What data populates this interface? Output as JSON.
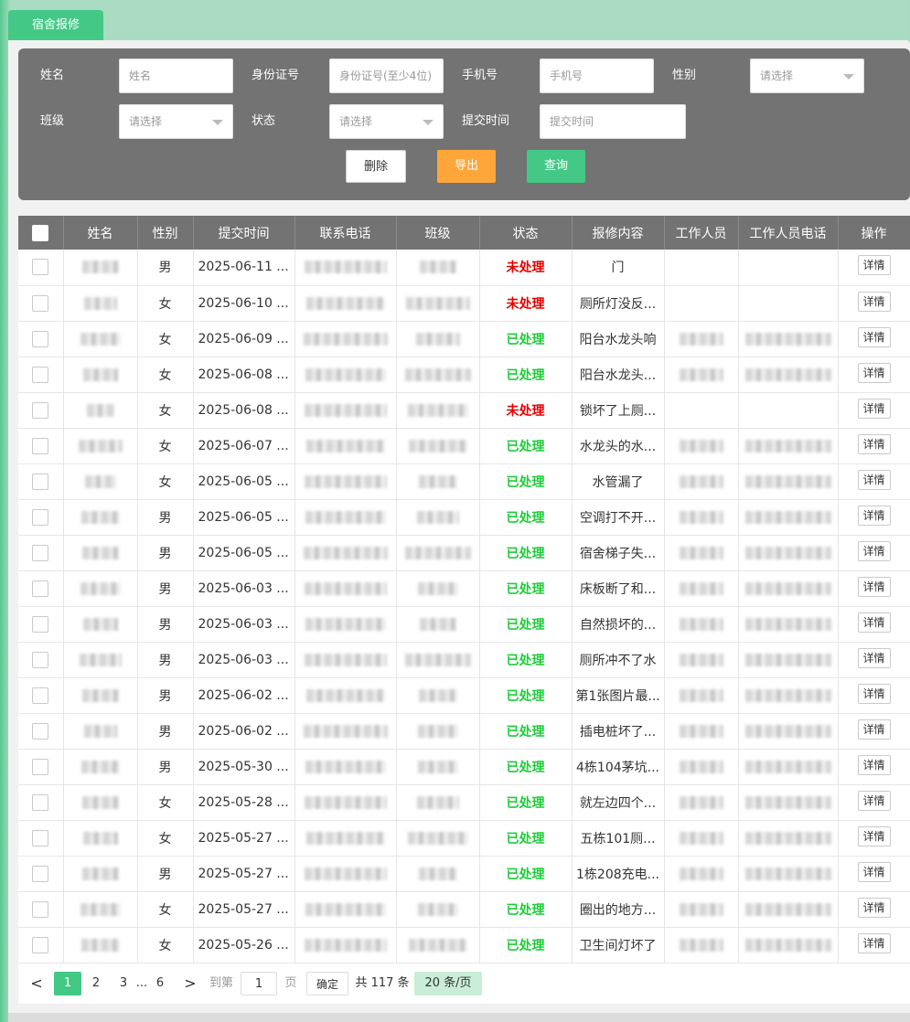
{
  "tab": {
    "label": "宿舍报修"
  },
  "filter": {
    "name_label": "姓名",
    "name_placeholder": "姓名",
    "id_label": "身份证号",
    "id_placeholder": "身份证号(至少4位)",
    "phone_label": "手机号",
    "phone_placeholder": "手机号",
    "gender_label": "性别",
    "gender_placeholder": "请选择",
    "class_label": "班级",
    "class_placeholder": "请选择",
    "status_label": "状态",
    "status_placeholder": "请选择",
    "time_label": "提交时间",
    "time_placeholder": "提交时间",
    "delete_label": "删除",
    "export_label": "导出",
    "query_label": "查询"
  },
  "table": {
    "headers": [
      "姓名",
      "性别",
      "提交时间",
      "联系电话",
      "班级",
      "状态",
      "报修内容",
      "工作人员",
      "工作人员电话",
      "操作"
    ],
    "detail_label": "详情",
    "rows": [
      {
        "gender": "男",
        "time": "2025-06-11 ...",
        "status": "未处理",
        "content": "门",
        "handled": false
      },
      {
        "gender": "女",
        "time": "2025-06-10 ...",
        "status": "未处理",
        "content": "厕所灯没反...",
        "handled": false
      },
      {
        "gender": "女",
        "time": "2025-06-09 ...",
        "status": "已处理",
        "content": "阳台水龙头响",
        "handled": true
      },
      {
        "gender": "女",
        "time": "2025-06-08 ...",
        "status": "已处理",
        "content": "阳台水龙头...",
        "handled": true
      },
      {
        "gender": "女",
        "time": "2025-06-08 ...",
        "status": "未处理",
        "content": "锁坏了上厕...",
        "handled": false
      },
      {
        "gender": "女",
        "time": "2025-06-07 ...",
        "status": "已处理",
        "content": "水龙头的水...",
        "handled": true
      },
      {
        "gender": "女",
        "time": "2025-06-05 ...",
        "status": "已处理",
        "content": "水管漏了",
        "handled": true
      },
      {
        "gender": "男",
        "time": "2025-06-05 ...",
        "status": "已处理",
        "content": "空调打不开...",
        "handled": true
      },
      {
        "gender": "男",
        "time": "2025-06-05 ...",
        "status": "已处理",
        "content": "宿舍梯子失...",
        "handled": true
      },
      {
        "gender": "男",
        "time": "2025-06-03 ...",
        "status": "已处理",
        "content": "床板断了和...",
        "handled": true
      },
      {
        "gender": "男",
        "time": "2025-06-03 ...",
        "status": "已处理",
        "content": "自然损坏的...",
        "handled": true
      },
      {
        "gender": "男",
        "time": "2025-06-03 ...",
        "status": "已处理",
        "content": "厕所冲不了水",
        "handled": true
      },
      {
        "gender": "男",
        "time": "2025-06-02 ...",
        "status": "已处理",
        "content": "第1张图片最...",
        "handled": true
      },
      {
        "gender": "男",
        "time": "2025-06-02 ...",
        "status": "已处理",
        "content": "插电桩坏了...",
        "handled": true
      },
      {
        "gender": "男",
        "time": "2025-05-30 ...",
        "status": "已处理",
        "content": "4栋104茅坑...",
        "handled": true
      },
      {
        "gender": "女",
        "time": "2025-05-28 ...",
        "status": "已处理",
        "content": "就左边四个...",
        "handled": true
      },
      {
        "gender": "女",
        "time": "2025-05-27 ...",
        "status": "已处理",
        "content": "五栋101厕...",
        "handled": true
      },
      {
        "gender": "男",
        "time": "2025-05-27 ...",
        "status": "已处理",
        "content": "1栋208充电...",
        "handled": true
      },
      {
        "gender": "女",
        "time": "2025-05-27 ...",
        "status": "已处理",
        "content": "圈出的地方...",
        "handled": true
      },
      {
        "gender": "女",
        "time": "2025-05-26 ...",
        "status": "已处理",
        "content": "卫生间灯坏了",
        "handled": true
      }
    ]
  },
  "pager": {
    "prev": "<",
    "pages": [
      "1",
      "2",
      "3"
    ],
    "ellipsis": "...",
    "last": "6",
    "next": ">",
    "goto_label": "到第",
    "goto_value": "1",
    "page_unit": "页",
    "confirm": "确定",
    "total": "共 117 条",
    "page_size": "20 条/页"
  },
  "colors": {
    "accent": "#43c886",
    "export": "#ffa63a",
    "pending": "#e60000",
    "done": "#1fcc3a",
    "header": "#737373"
  }
}
